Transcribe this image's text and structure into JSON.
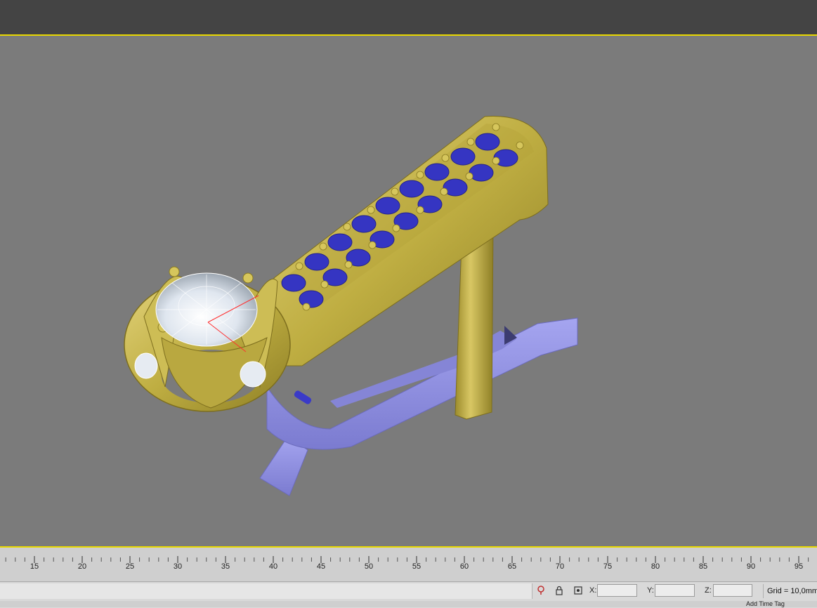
{
  "colors": {
    "accent": "#e8d800",
    "gold": "#c8b84e",
    "stone": "#3a3ac8",
    "support": "#8f8fe0"
  },
  "timeline": {
    "ticks": [
      "15",
      "20",
      "25",
      "30",
      "35",
      "40",
      "45",
      "50",
      "55",
      "60",
      "65",
      "70",
      "75",
      "80",
      "85",
      "90",
      "95"
    ]
  },
  "status": {
    "x_label": "X:",
    "y_label": "Y:",
    "z_label": "Z:",
    "x_value": "",
    "y_value": "",
    "z_value": "",
    "grid_text": "Grid = 10,0mm",
    "add_time_tag": "Add Time Tag",
    "icons": [
      "selection-lock-icon",
      "lock-icon",
      "absolute-mode-icon"
    ]
  }
}
